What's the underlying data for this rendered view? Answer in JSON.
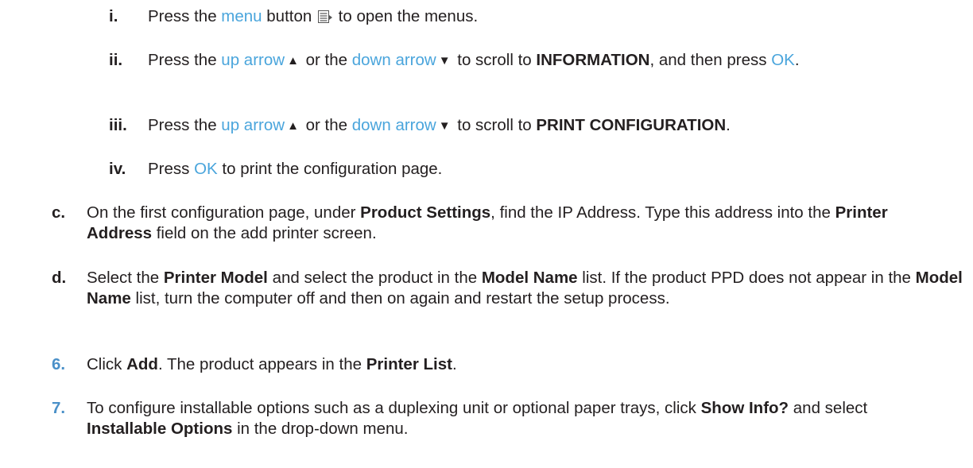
{
  "steps": {
    "i": {
      "marker": "i.",
      "t1": "Press the ",
      "menu_link": "menu",
      "t2": " button ",
      "t3": " to open the menus."
    },
    "ii": {
      "marker": "ii.",
      "t1": "Press the ",
      "up_link": "up arrow",
      "up_symbol": "▲",
      "t2": " or the ",
      "down_link": "down arrow",
      "down_symbol": "▼",
      "t3": " to scroll to ",
      "target": "INFORMATION",
      "t4": ", and then press ",
      "ok_link": "OK",
      "t5": "."
    },
    "iii": {
      "marker": "iii.",
      "t1": "Press the ",
      "up_link": "up arrow",
      "up_symbol": "▲",
      "t2": " or the ",
      "down_link": "down arrow",
      "down_symbol": "▼",
      "t3": " to scroll to ",
      "target": "PRINT CONFIGURATION",
      "t4": "."
    },
    "iv": {
      "marker": "iv.",
      "t1": "Press ",
      "ok_link": "OK",
      "t2": " to print the configuration page."
    },
    "c": {
      "marker": "c.",
      "t1": "On the first configuration page, under ",
      "b1": "Product Settings",
      "t2": ", find the IP Address. Type this address into the ",
      "b2": "Printer Address",
      "t3": " field on the add printer screen."
    },
    "d": {
      "marker": "d.",
      "t1": "Select the ",
      "b1": "Printer Model",
      "t2": " and select the product in the ",
      "b2": "Model Name",
      "t3": " list. If the product PPD does not appear in the ",
      "b3": "Model Name",
      "t4": " list, turn the computer off and then on again and restart the setup process."
    },
    "s6": {
      "marker": "6.",
      "t1": "Click ",
      "b1": "Add",
      "t2": ". The product appears in the ",
      "b2": "Printer List",
      "t3": "."
    },
    "s7": {
      "marker": "7.",
      "t1": "To configure installable options such as a duplexing unit or optional paper trays, click ",
      "b1": "Show Info?",
      "t2": " and select ",
      "b2": "Installable Options",
      "t3": " in the drop-down menu."
    }
  },
  "icons": {
    "menu_button": "menu-button-icon"
  },
  "colors": {
    "link": "#4aa5dc",
    "step_number": "#4a90c8",
    "text": "#231f20"
  }
}
